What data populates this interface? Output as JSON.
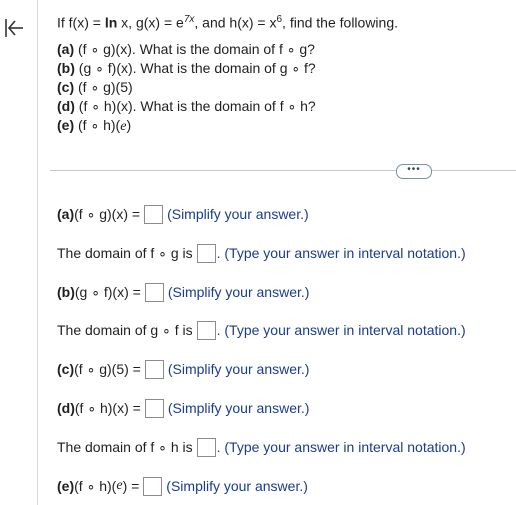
{
  "nav": {
    "back_icon": "collapse-left-arrow-icon"
  },
  "problem": {
    "intro": {
      "p1": "If f(x) = ",
      "f_def": "ln",
      "p2": " x, g(x) = e",
      "g_exp": "7x",
      "p3": ", and h(x) = x",
      "h_exp": "6",
      "p4": ", find the following."
    },
    "parts": [
      {
        "label": "(a)",
        "text": " (f ∘ g)(x). What is the domain of f ∘ g?"
      },
      {
        "label": "(b)",
        "text": " (g ∘ f)(x). What is the domain of g ∘ f?"
      },
      {
        "label": "(c)",
        "text": " (f ∘ g)(5)"
      },
      {
        "label": "(d)",
        "text": " (f ∘ h)(x). What is the domain of f ∘ h?"
      },
      {
        "label": "(e)",
        "text": " (f ∘ h)(",
        "var": "e",
        "close": ")"
      }
    ]
  },
  "more_button": "•••",
  "answers": {
    "a_expr": {
      "label": "(a)",
      "text": " (f ∘ g)(x) =",
      "hint": "(Simplify your answer.)"
    },
    "a_domain": {
      "text": "The domain of f ∘ g is",
      "hint": ". (Type your answer in interval notation.)"
    },
    "b_expr": {
      "label": "(b)",
      "text": " (g ∘ f)(x) =",
      "hint": "(Simplify your answer.)"
    },
    "b_domain": {
      "text": "The domain of g ∘ f is",
      "hint": ". (Type your answer in interval notation.)"
    },
    "c_expr": {
      "label": "(c)",
      "text": " (f ∘ g)(5) =",
      "hint": "(Simplify your answer.)"
    },
    "d_expr": {
      "label": "(d)",
      "text": " (f ∘ h)(x) =",
      "hint": "(Simplify your answer.)"
    },
    "d_domain": {
      "text": "The domain of f ∘ h is",
      "hint": ". (Type your answer in interval notation.)"
    },
    "e_expr": {
      "label": "(e)",
      "text": " (f ∘ h)(",
      "var": "e",
      "close": ") =",
      "hint": "(Simplify your answer.)"
    }
  }
}
